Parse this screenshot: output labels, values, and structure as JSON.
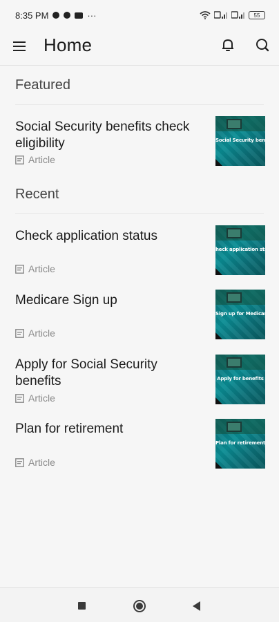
{
  "status_bar": {
    "time": "8:35 PM",
    "ellipsis": "···",
    "battery": "55"
  },
  "app_bar": {
    "title": "Home"
  },
  "featured": {
    "header": "Featured",
    "items": [
      {
        "title": "Social Security benefits check eligibility",
        "type": "Article",
        "thumb_text": "Social Security benefit"
      }
    ]
  },
  "recent": {
    "header": "Recent",
    "items": [
      {
        "title": "Check application status",
        "type": "Article",
        "thumb_text": "heck application statu"
      },
      {
        "title": "Medicare Sign up",
        "type": "Article",
        "thumb_text": "Sign up for Medicare"
      },
      {
        "title": "Apply for Social Security benefits",
        "type": "Article",
        "thumb_text": "Apply for benefits"
      },
      {
        "title": "Plan for retirement",
        "type": "Article",
        "thumb_text": "Plan for retirement"
      }
    ]
  },
  "icons": {
    "menu": "menu-icon",
    "notifications": "bell-icon",
    "search": "search-icon",
    "article": "document-icon"
  },
  "colors": {
    "background": "#f6f6f6",
    "thumbnail": "#0a8d94"
  }
}
